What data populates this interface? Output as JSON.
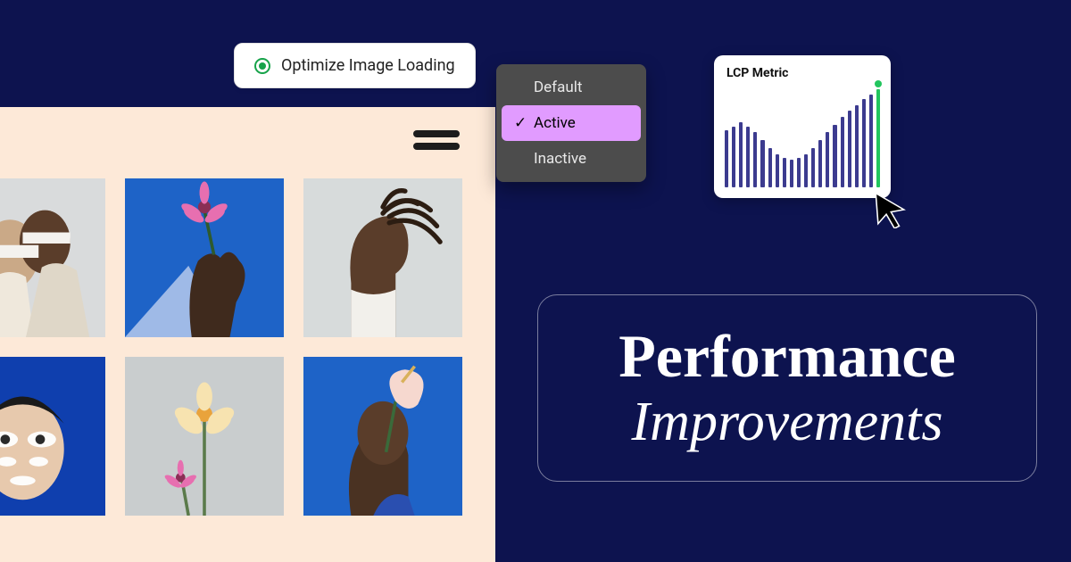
{
  "optimize": {
    "label": "Optimize Image Loading"
  },
  "menu": {
    "items": [
      {
        "label": "Default",
        "active": false
      },
      {
        "label": "Active",
        "active": true
      },
      {
        "label": "Inactive",
        "active": false
      }
    ]
  },
  "metric": {
    "title": "LCP Metric"
  },
  "headline": {
    "line1": "Performance",
    "line2": "Improvements"
  },
  "gallery": {
    "thumbs": [
      "portrait-duo-blindfold",
      "hand-holding-pink-flower",
      "profile-man-locs",
      "woman-white-facepaint",
      "two-flowers-grey",
      "man-anthurium-flower"
    ]
  },
  "chart_data": {
    "type": "bar",
    "title": "LCP Metric",
    "xlabel": "",
    "ylabel": "",
    "ylim": [
      0,
      100
    ],
    "categories": [
      "1",
      "2",
      "3",
      "4",
      "5",
      "6",
      "7",
      "8",
      "9",
      "10",
      "11",
      "12",
      "13",
      "14",
      "15",
      "16",
      "17",
      "18",
      "19",
      "20",
      "21",
      "22"
    ],
    "values": [
      58,
      62,
      66,
      62,
      56,
      48,
      40,
      34,
      30,
      28,
      30,
      34,
      40,
      48,
      56,
      64,
      72,
      78,
      84,
      90,
      95,
      100
    ],
    "highlight_index": 21,
    "colors": {
      "bar": "#3c3b8f",
      "highlight": "#22c55e"
    }
  }
}
